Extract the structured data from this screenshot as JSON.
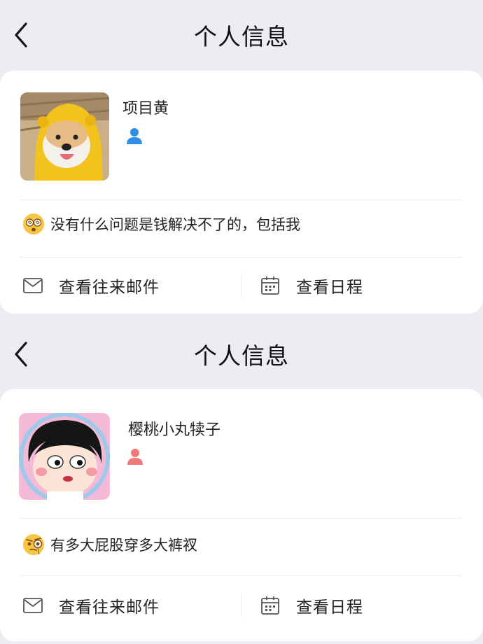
{
  "screens": [
    {
      "title": "个人信息",
      "name": "项目黄",
      "person_icon_color": "#2f8fe6",
      "signature_emoji": "dizzy-face-emoji",
      "signature": "没有什么问题是钱解决不了的，包括我",
      "actions": {
        "mail_label": "查看往来邮件",
        "schedule_label": "查看日程"
      }
    },
    {
      "title": "个人信息",
      "name": "樱桃小丸犊子",
      "person_icon_color": "#f07a7a",
      "signature_emoji": "monocle-face-emoji",
      "signature": "有多大屁股穿多大裤衩",
      "actions": {
        "mail_label": "查看往来邮件",
        "schedule_label": "查看日程"
      }
    }
  ]
}
